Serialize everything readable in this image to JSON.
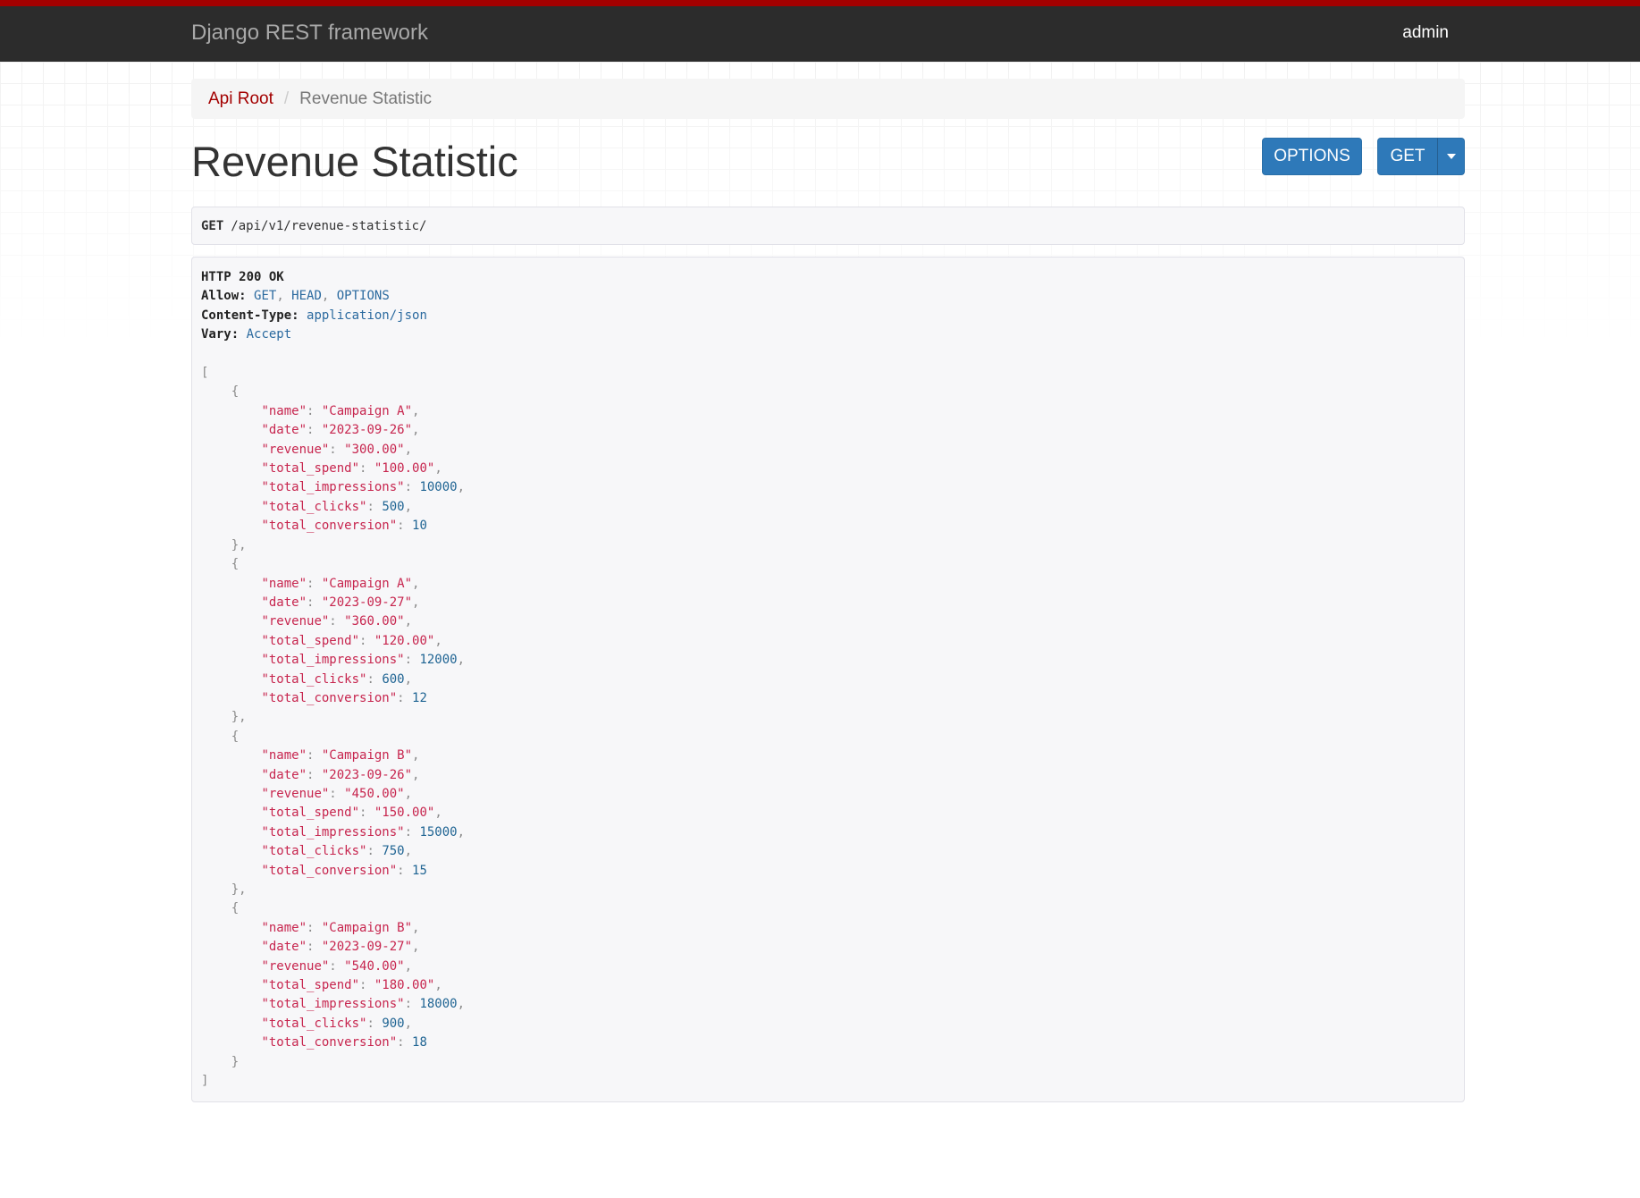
{
  "navbar": {
    "brand": "Django REST framework",
    "user": "admin"
  },
  "breadcrumb": {
    "root": "Api Root",
    "current": "Revenue Statistic"
  },
  "page": {
    "title": "Revenue Statistic",
    "options_label": "OPTIONS",
    "get_label": "GET"
  },
  "request": {
    "method": "GET",
    "path": "/api/v1/revenue-statistic/"
  },
  "response": {
    "status": "HTTP 200 OK",
    "headers": [
      {
        "key": "Allow:",
        "value": "GET, HEAD, OPTIONS"
      },
      {
        "key": "Content-Type:",
        "value": "application/json"
      },
      {
        "key": "Vary:",
        "value": "Accept"
      }
    ],
    "records": [
      {
        "name": "Campaign A",
        "date": "2023-09-26",
        "revenue": "300.00",
        "total_spend": "100.00",
        "total_impressions": 10000,
        "total_clicks": 500,
        "total_conversion": 10
      },
      {
        "name": "Campaign A",
        "date": "2023-09-27",
        "revenue": "360.00",
        "total_spend": "120.00",
        "total_impressions": 12000,
        "total_clicks": 600,
        "total_conversion": 12
      },
      {
        "name": "Campaign B",
        "date": "2023-09-26",
        "revenue": "450.00",
        "total_spend": "150.00",
        "total_impressions": 15000,
        "total_clicks": 750,
        "total_conversion": 15
      },
      {
        "name": "Campaign B",
        "date": "2023-09-27",
        "revenue": "540.00",
        "total_spend": "180.00",
        "total_impressions": 18000,
        "total_clicks": 900,
        "total_conversion": 18
      }
    ]
  },
  "colors": {
    "accent_red": "#a30000",
    "button_blue": "#2e79b9",
    "navbar_bg": "#2c2c2c"
  }
}
